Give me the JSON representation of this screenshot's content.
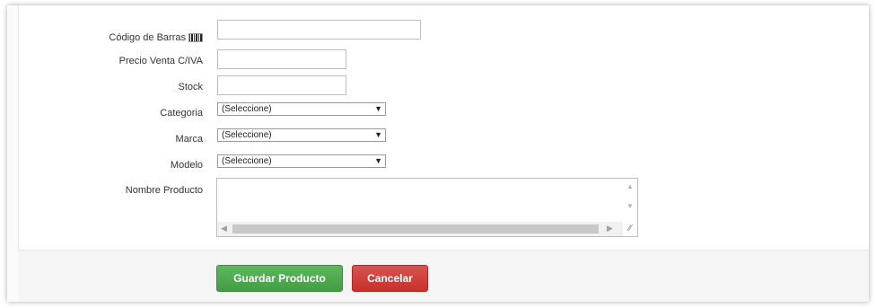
{
  "form": {
    "barcode_label": "Código de Barras",
    "barcode_value": "",
    "price_label": "Precio Venta C/IVA",
    "price_value": "",
    "stock_label": "Stock",
    "stock_value": "",
    "category_label": "Categoria",
    "category_selected": "(Seleccione)",
    "brand_label": "Marca",
    "brand_selected": "(Seleccione)",
    "model_label": "Modelo",
    "model_selected": "(Seleccione)",
    "name_label": "Nombre Producto",
    "name_value": ""
  },
  "actions": {
    "save_label": "Guardar Producto",
    "cancel_label": "Cancelar"
  },
  "icons": {
    "barcode": "barcode-icon",
    "dropdown": "chevron-down-icon"
  },
  "colors": {
    "save": "#5cb85c",
    "cancel": "#d9534f"
  }
}
